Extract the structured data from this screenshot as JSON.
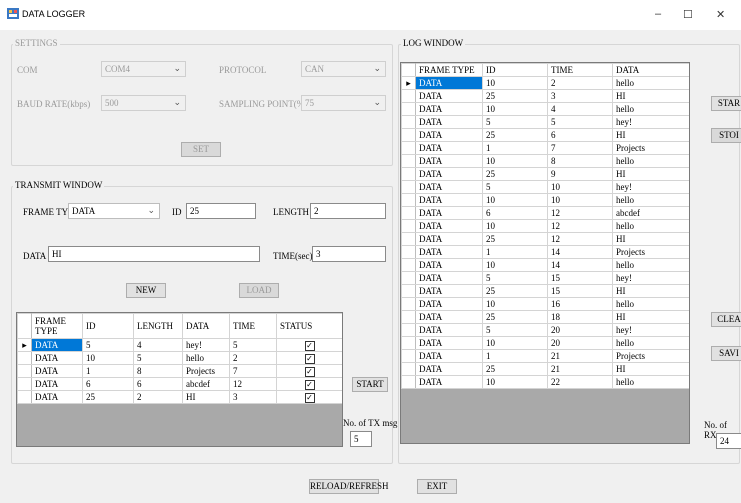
{
  "window": {
    "title": "DATA LOGGER",
    "minimize": "–",
    "maximize": "☐",
    "close": "✕"
  },
  "settings": {
    "label": "SETTINGS",
    "com_label": "COM",
    "com_value": "COM4",
    "protocol_label": "PROTOCOL",
    "protocol_value": "CAN",
    "baud_label": "BAUD RATE(kbps)",
    "baud_value": "500",
    "sampling_label": "SAMPLING POINT(%)",
    "sampling_value": "75",
    "set_button": "SET"
  },
  "transmit": {
    "label": "TRANSMIT WINDOW",
    "frame_type_label": "FRAME TYPE",
    "frame_type_value": "DATA",
    "id_label": "ID",
    "id_value": "25",
    "length_label": "LENGTH",
    "length_value": "2",
    "data_label": "DATA",
    "data_value": "HI",
    "time_label": "TIME(sec)",
    "time_value": "3",
    "new_button": "NEW",
    "load_button": "LOAD",
    "start_button": "START",
    "tx_count_label": "No. of TX msg",
    "tx_count_value": "5",
    "columns": [
      "FRAME TYPE",
      "ID",
      "LENGTH",
      "DATA",
      "TIME",
      "STATUS"
    ],
    "rows": [
      [
        "DATA",
        "5",
        "4",
        "hey!",
        "5"
      ],
      [
        "DATA",
        "10",
        "5",
        "hello",
        "2"
      ],
      [
        "DATA",
        "1",
        "8",
        "Projects",
        "7"
      ],
      [
        "DATA",
        "6",
        "6",
        "abcdef",
        "12"
      ],
      [
        "DATA",
        "25",
        "2",
        "HI",
        "3"
      ]
    ]
  },
  "log": {
    "label": "LOG WINDOW",
    "columns": [
      "FRAME TYPE",
      "ID",
      "TIME",
      "DATA"
    ],
    "rows": [
      [
        "DATA",
        "10",
        "2",
        "hello"
      ],
      [
        "DATA",
        "25",
        "3",
        "HI"
      ],
      [
        "DATA",
        "10",
        "4",
        "hello"
      ],
      [
        "DATA",
        "5",
        "5",
        "hey!"
      ],
      [
        "DATA",
        "25",
        "6",
        "HI"
      ],
      [
        "DATA",
        "1",
        "7",
        "Projects"
      ],
      [
        "DATA",
        "10",
        "8",
        "hello"
      ],
      [
        "DATA",
        "25",
        "9",
        "HI"
      ],
      [
        "DATA",
        "5",
        "10",
        "hey!"
      ],
      [
        "DATA",
        "10",
        "10",
        "hello"
      ],
      [
        "DATA",
        "6",
        "12",
        "abcdef"
      ],
      [
        "DATA",
        "10",
        "12",
        "hello"
      ],
      [
        "DATA",
        "25",
        "12",
        "HI"
      ],
      [
        "DATA",
        "1",
        "14",
        "Projects"
      ],
      [
        "DATA",
        "10",
        "14",
        "hello"
      ],
      [
        "DATA",
        "5",
        "15",
        "hey!"
      ],
      [
        "DATA",
        "25",
        "15",
        "HI"
      ],
      [
        "DATA",
        "10",
        "16",
        "hello"
      ],
      [
        "DATA",
        "25",
        "18",
        "HI"
      ],
      [
        "DATA",
        "5",
        "20",
        "hey!"
      ],
      [
        "DATA",
        "10",
        "20",
        "hello"
      ],
      [
        "DATA",
        "1",
        "21",
        "Projects"
      ],
      [
        "DATA",
        "25",
        "21",
        "HI"
      ],
      [
        "DATA",
        "10",
        "22",
        "hello"
      ]
    ],
    "start_button": "STAR",
    "stop_button": "STOI",
    "clear_button": "CLEA",
    "save_button": "SAVI",
    "rx_count_label": "No. of RX r",
    "rx_count_value": "24"
  },
  "footer": {
    "reload_button": "RELOAD/REFRESH",
    "exit_button": "EXIT"
  }
}
